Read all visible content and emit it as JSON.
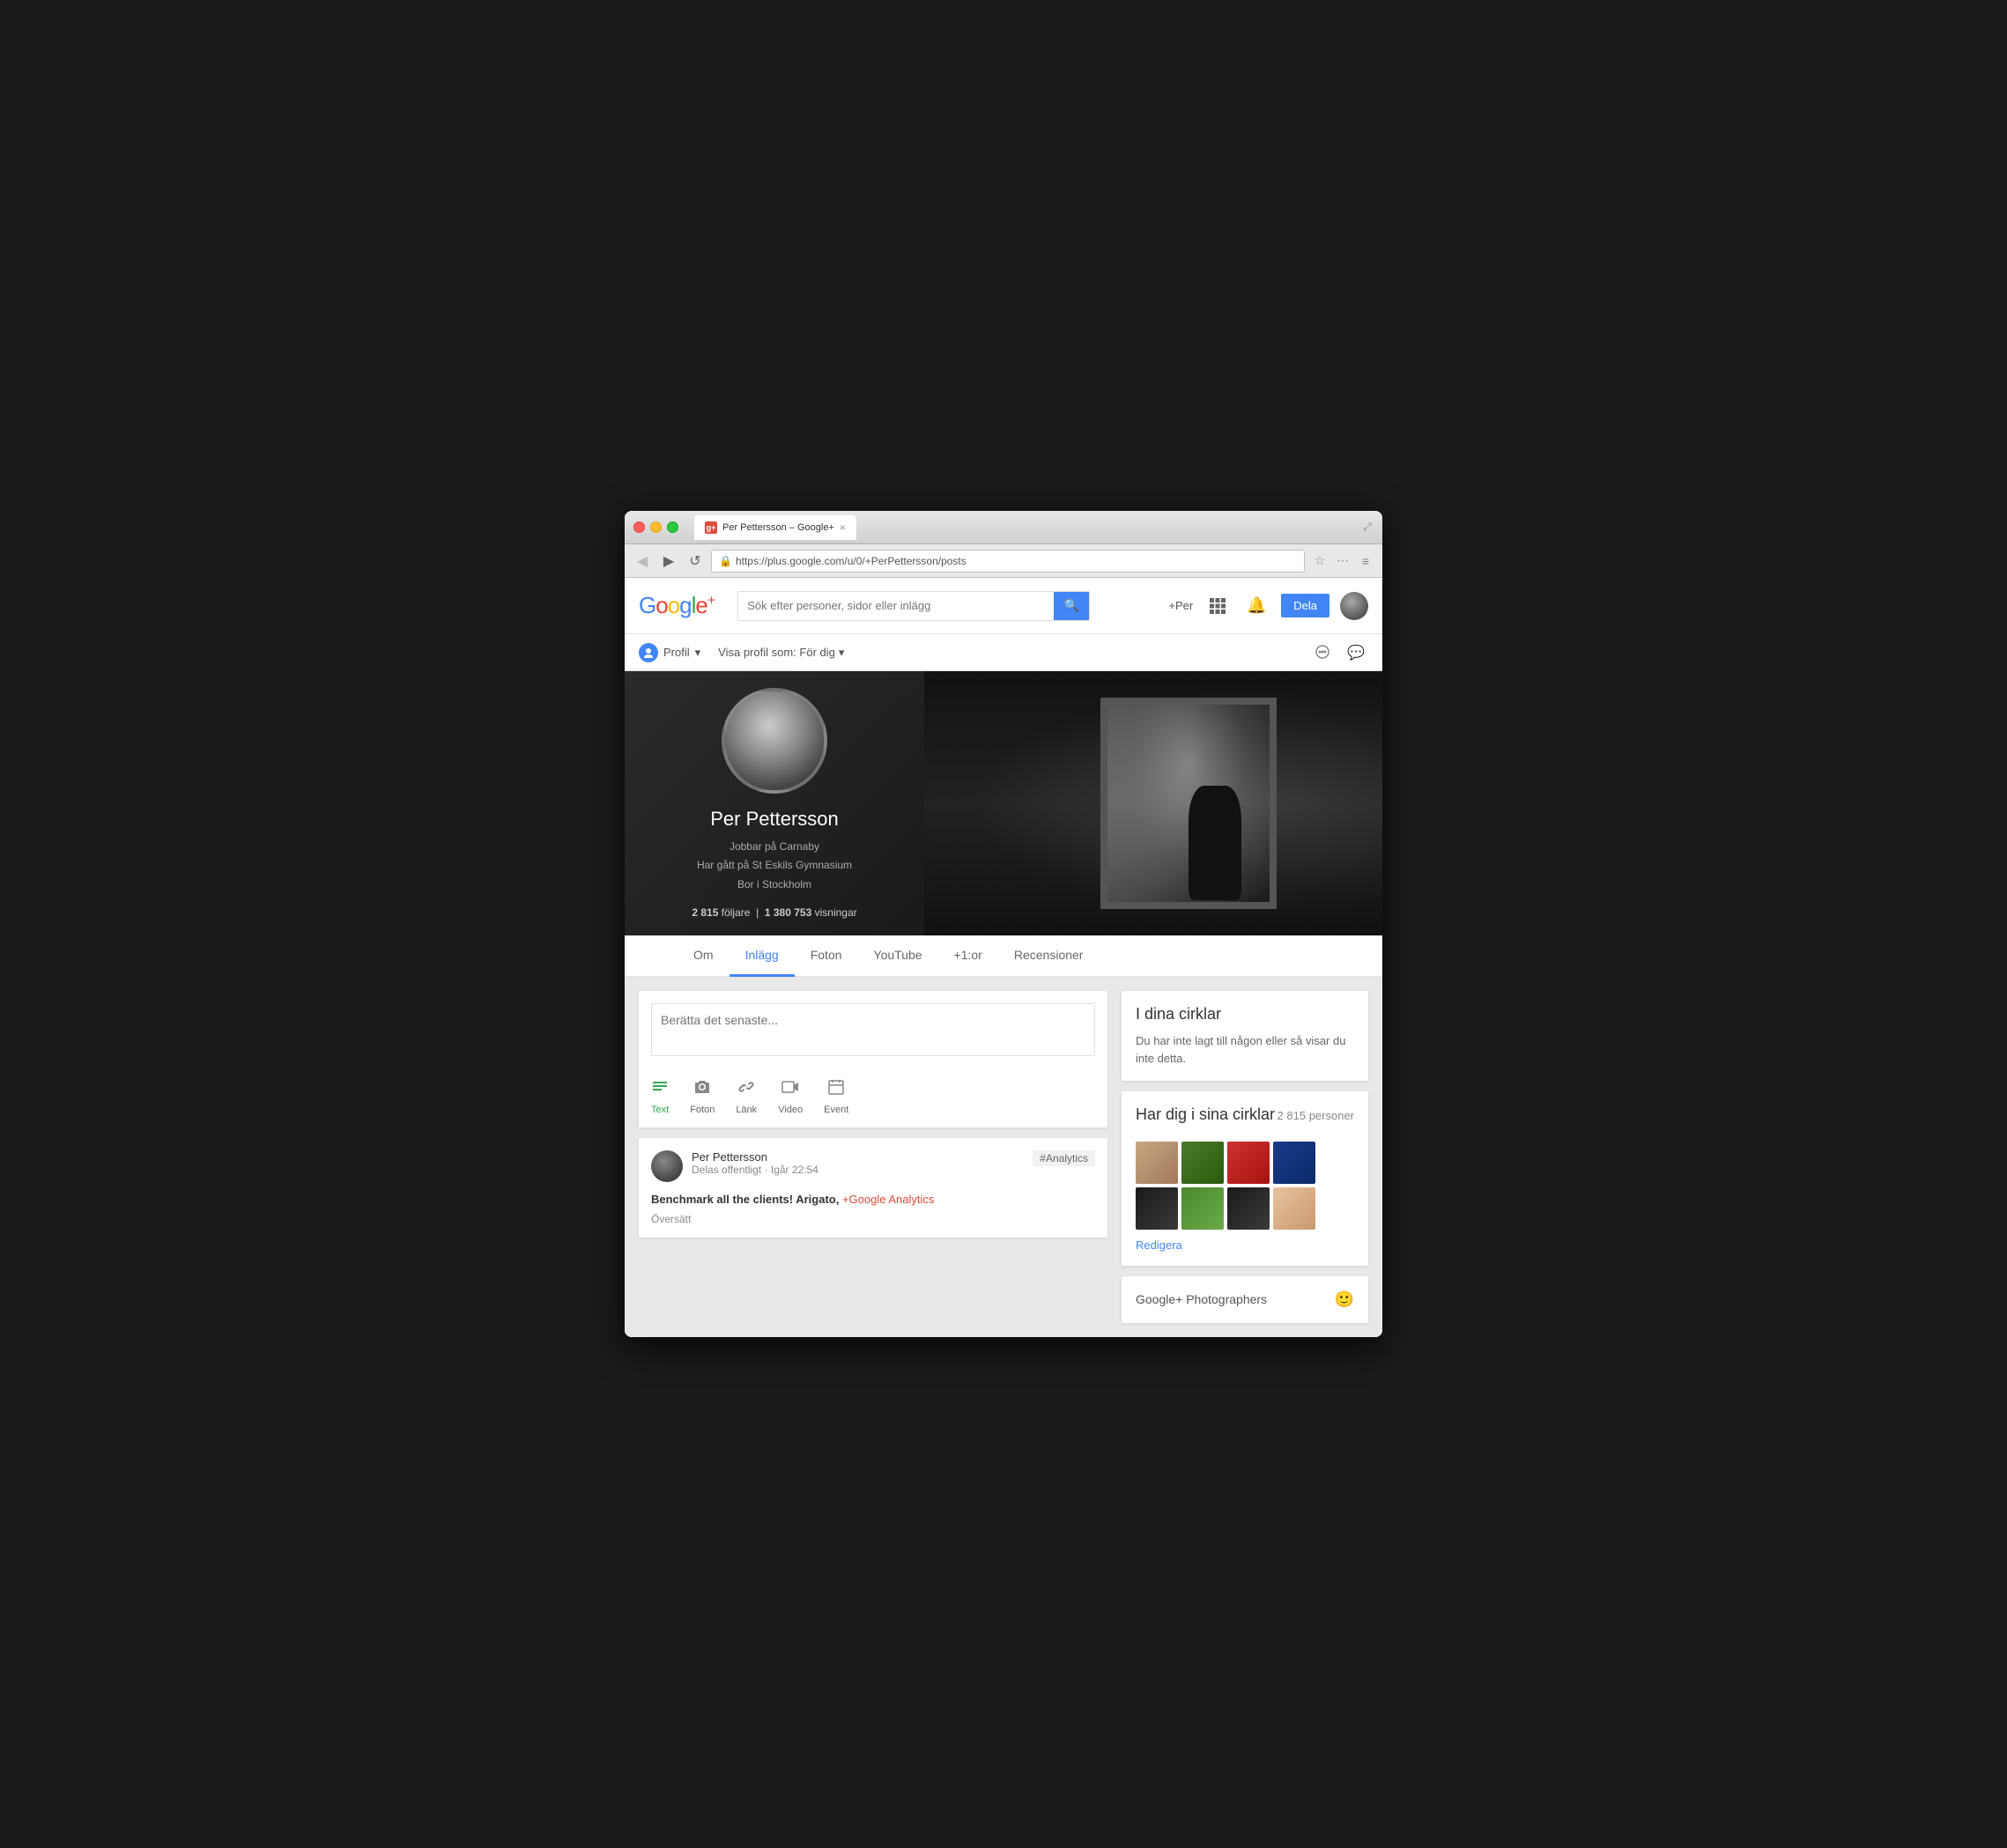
{
  "browser": {
    "tab_title": "Per Pettersson – Google+",
    "tab_close": "×",
    "url": "https://plus.google.com/u/0/+PerPettersson/posts",
    "back_label": "◀",
    "forward_label": "▶",
    "reload_label": "↺",
    "bookmark_icon": "☆",
    "more_icon": "≡",
    "fullscreen_icon": "⤢"
  },
  "header": {
    "logo_g": "G",
    "logo_plus": "+",
    "search_placeholder": "Sök efter personer, sidor eller inlägg",
    "search_icon": "🔍",
    "plus_per": "+Per",
    "apps_icon": "⋮⋮⋮",
    "bell_icon": "🔔",
    "share_label": "Dela"
  },
  "profile_nav": {
    "profile_label": "Profil",
    "view_as_label": "Visa profil som: För dig",
    "dropdown_arrow": "▾",
    "cloud_icon": "☁",
    "chat_icon": "💬"
  },
  "cover": {
    "name": "Per Pettersson",
    "job": "Jobbar på Carnaby",
    "school": "Har gått på St Eskils Gymnasium",
    "location": "Bor i Stockholm",
    "followers_label": "följare",
    "followers_count": "2 815",
    "views_label": "visningar",
    "views_count": "1 380 753",
    "separator": "|"
  },
  "tabs": {
    "items": [
      {
        "id": "om",
        "label": "Om"
      },
      {
        "id": "inlagg",
        "label": "Inlägg",
        "active": true
      },
      {
        "id": "foton",
        "label": "Foton"
      },
      {
        "id": "youtube",
        "label": "YouTube"
      },
      {
        "id": "plus1or",
        "label": "+1:or"
      },
      {
        "id": "recensioner",
        "label": "Recensioner"
      }
    ]
  },
  "composer": {
    "placeholder": "Berätta det senaste...",
    "action_text": "Text",
    "action_photos": "Foton",
    "action_link": "Länk",
    "action_video": "Video",
    "action_event": "Event"
  },
  "post": {
    "author": "Per Pettersson",
    "visibility": "Delas offentligt",
    "time": "Igår 22:54",
    "separator": "·",
    "tag": "#Analytics",
    "content_prefix": "Benchmark all the clients! Arigato, ",
    "content_mention": "+Google Analytics",
    "translate_label": "Översätt"
  },
  "right_panel": {
    "circles_title": "I dina cirklar",
    "circles_empty": "Du har inte lagt till någon eller så visar du inte detta.",
    "has_you_title": "Har dig i sina cirklar",
    "has_you_count": "2 815 personer",
    "edit_label": "Redigera",
    "photographers_title": "Google+ Photographers"
  }
}
